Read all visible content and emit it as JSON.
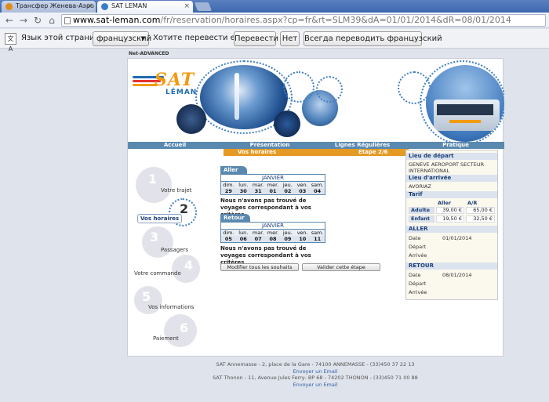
{
  "browser": {
    "tabs": [
      {
        "label": "Трансфер Женева-Аэро",
        "active": false,
        "favicon_color": "#e38a1a"
      },
      {
        "label": "SAT LEMAN",
        "active": true,
        "favicon_color": "#3a7dc9"
      }
    ],
    "url_host": "www.sat-leman.com",
    "url_rest": "/fr/reservation/horaires.aspx?cp=fr&rt=SLM39&dA=01/01/2014&dR=08/01/2014"
  },
  "translate_bar": {
    "language_label": "Язык этой страницы",
    "language_value": "французский",
    "question": "Хотите перевести ее?",
    "translate_button": "Перевести",
    "no_button": "Нет",
    "always_button": "Всегда переводить французский"
  },
  "site": {
    "net_advanced": "Net-ADVANCED",
    "logo_text": "SAT",
    "logo_subtext": "LÉMAN",
    "menu": [
      "Accueil",
      "Présentation",
      "Lignes Régulières",
      "Pratique"
    ],
    "submenu": [
      "Vos horaires",
      "Etape 2/6"
    ]
  },
  "steps": [
    {
      "num": "1",
      "label": "Votre trajet"
    },
    {
      "num": "2",
      "label": "Vos horaires"
    },
    {
      "num": "3",
      "label": "Passagers"
    },
    {
      "num": "4",
      "label": "Votre commande"
    },
    {
      "num": "5",
      "label": "Vos informations"
    },
    {
      "num": "6",
      "label": "Paiement"
    }
  ],
  "aller": {
    "tag": "Aller",
    "month": "JANVIER",
    "days": [
      "dim.",
      "lun.",
      "mar.",
      "mer.",
      "jeu.",
      "ven.",
      "sam."
    ],
    "dates": [
      "29",
      "30",
      "31",
      "01",
      "02",
      "03",
      "04"
    ],
    "message": "Nous n'avons pas trouvé de voyages correspondant à vos critères"
  },
  "retour": {
    "tag": "Retour",
    "month": "JANVIER",
    "days": [
      "dim.",
      "lun.",
      "mar.",
      "mer.",
      "jeu.",
      "ven.",
      "sam."
    ],
    "dates": [
      "05",
      "06",
      "07",
      "08",
      "09",
      "10",
      "11"
    ],
    "message": "Nous n'avons pas trouvé de voyages correspondant à vos critères"
  },
  "buttons": {
    "modify": "Modifier tous les souhaits",
    "validate": "Valider cette étape"
  },
  "summary": {
    "depart_header": "Lieu de départ",
    "depart_value": "GENEVE AEROPORT SECTEUR INTERNATIONAL",
    "arrivee_header": "Lieu d'arrivée",
    "arrivee_value": "AVORIAZ",
    "tarif_header": "Tarif",
    "col_aller": "Aller",
    "col_ar": "A/R",
    "adulte_label": "Adulte",
    "adulte_aller": "39,00 €",
    "adulte_ar": "65,00 €",
    "enfant_label": "Enfant",
    "enfant_aller": "19,50 €",
    "enfant_ar": "32,50 €",
    "aller_header": "ALLER",
    "aller_date_label": "Date",
    "aller_date": "01/01/2014",
    "aller_depart_label": "Départ",
    "aller_arrivee_label": "Arrivée",
    "retour_header": "RETOUR",
    "retour_date_label": "Date",
    "retour_date": "08/01/2014",
    "retour_depart_label": "Départ",
    "retour_arrivee_label": "Arrivée"
  },
  "footer": {
    "line1": "SAT Annemasse - 2, place de la Gare - 74100 ANNEMASSE - (33)450 37 22 13",
    "email1": "Envoyer un Email",
    "line2": "SAT Thonon - 11, Avenue Jules Ferry- BP 68 - 74202 THONON - (33)450 71 00 88",
    "email2": "Envoyer un Email"
  }
}
